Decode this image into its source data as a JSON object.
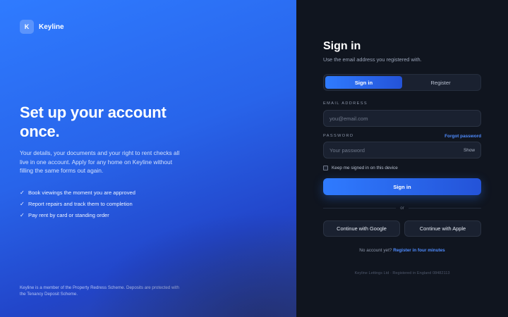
{
  "brand": {
    "mark": "K",
    "name": "Keyline"
  },
  "promo": {
    "headline": "Set up your account once.",
    "lead": "Your details, your documents and your right to rent checks all live in one account. Apply for any home on Keyline without filling the same forms out again.",
    "benefits": [
      "Book viewings the moment you are approved",
      "Report repairs and track them to completion",
      "Pay rent by card or standing order"
    ],
    "check_glyph": "✓",
    "footnote": "Keyline is a member of the Property Redress Scheme. Deposits are protected with the Tenancy Deposit Scheme."
  },
  "auth": {
    "title": "Sign in",
    "subtitle": "Use the email address you registered with.",
    "tabs": [
      {
        "label": "Sign in",
        "active": true
      },
      {
        "label": "Register",
        "active": false
      }
    ],
    "email": {
      "label": "EMAIL ADDRESS",
      "value": "",
      "placeholder": "you@email.com"
    },
    "password": {
      "label": "PASSWORD",
      "value": "",
      "placeholder": "Your password",
      "toggle": "Show"
    },
    "forgot": "Forgot password",
    "remember": {
      "label": "Keep me signed in on this device",
      "checked": false
    },
    "submit": "Sign in",
    "divider": "or",
    "social": {
      "google": "Continue with Google",
      "apple": "Continue with Apple"
    },
    "register_prompt": "No account yet?",
    "register_link": "Register in four minutes",
    "legal": "Keyline Lettings Ltd · Registered in England 08482113"
  },
  "colors": {
    "accent": "#2f7bff",
    "panel": "#10151f",
    "link": "#4f8cff"
  }
}
